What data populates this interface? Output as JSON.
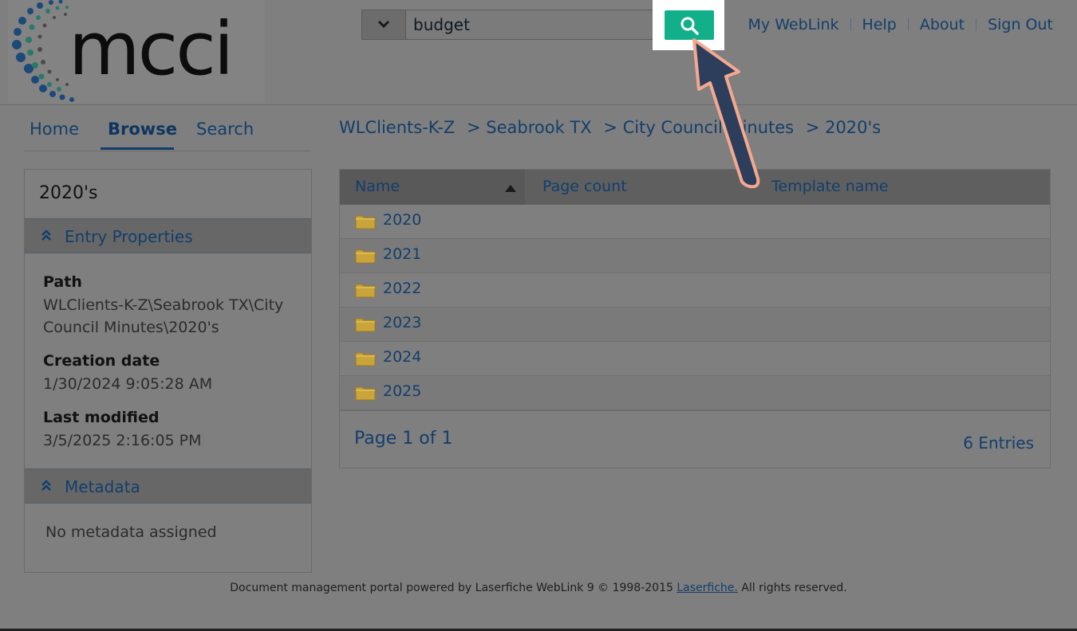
{
  "logo": {
    "text": "mcci"
  },
  "search": {
    "value": "budget",
    "dropdown_icon": "chevron-down-icon",
    "button_icon": "search-icon",
    "button_color": "#12b08a"
  },
  "top_nav": [
    "My WebLink",
    "Help",
    "About",
    "Sign Out"
  ],
  "tabs": {
    "home": "Home",
    "browse": "Browse",
    "search": "Search"
  },
  "breadcrumb": [
    "WLClients-K-Z",
    "> Seabrook TX",
    "> City Council Minutes",
    "> 2020's"
  ],
  "panel": {
    "title": "2020's",
    "entry_properties": "Entry Properties",
    "path_label": "Path",
    "path_value": "WLClients-K-Z\\Seabrook TX\\City Council Minutes\\2020's",
    "creation_label": "Creation date",
    "creation_value": "1/30/2024 9:05:28 AM",
    "modified_label": "Last modified",
    "modified_value": "3/5/2025 2:16:05 PM",
    "metadata": "Metadata",
    "no_metadata": "No metadata assigned"
  },
  "table": {
    "columns": {
      "name": "Name",
      "page_count": "Page count",
      "template": "Template name"
    },
    "rows": [
      "2020",
      "2021",
      "2022",
      "2023",
      "2024",
      "2025"
    ],
    "page_info": "Page 1 of 1",
    "entries": "6 Entries"
  },
  "footer": {
    "text_before": "Document management portal powered by Laserfiche WebLink 9 © 1998-2015 ",
    "link": "Laserfiche.",
    "text_after": " All rights reserved."
  },
  "colors": {
    "overlay": "#7f7f7f",
    "link": "#133e6b",
    "folder": "#c9a43a",
    "arrow": "#2d3e5c",
    "arrow_outline": "#f4a98f"
  }
}
